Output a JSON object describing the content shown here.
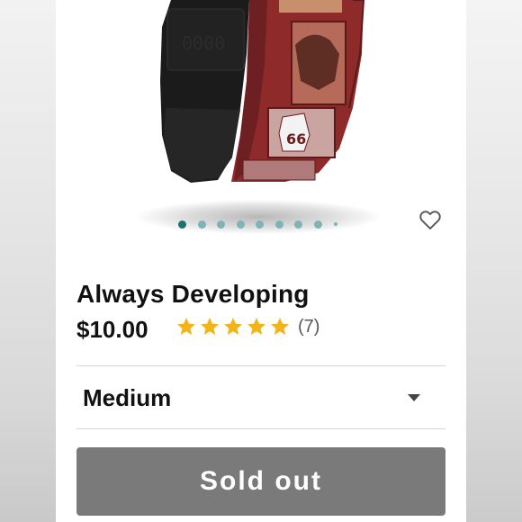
{
  "product": {
    "title": "Always Developing",
    "price": "$10.00",
    "rating": 5,
    "review_count": "(7)",
    "image": {
      "band_color": "#8e2a2a",
      "strap_color": "#1a1a1a",
      "badge_text": "66"
    }
  },
  "carousel": {
    "total_dots": 8,
    "active_index": 0,
    "active_color": "#1f6f73",
    "inactive_color": "#7fb3b5"
  },
  "wishlist": {
    "icon": "heart-outline-icon"
  },
  "size_selector": {
    "value": "Medium",
    "icon": "chevron-down-icon"
  },
  "action": {
    "label": "Sold out",
    "color": "#7a7a7a"
  },
  "colors": {
    "star": "#f3b419",
    "text": "#111111"
  }
}
